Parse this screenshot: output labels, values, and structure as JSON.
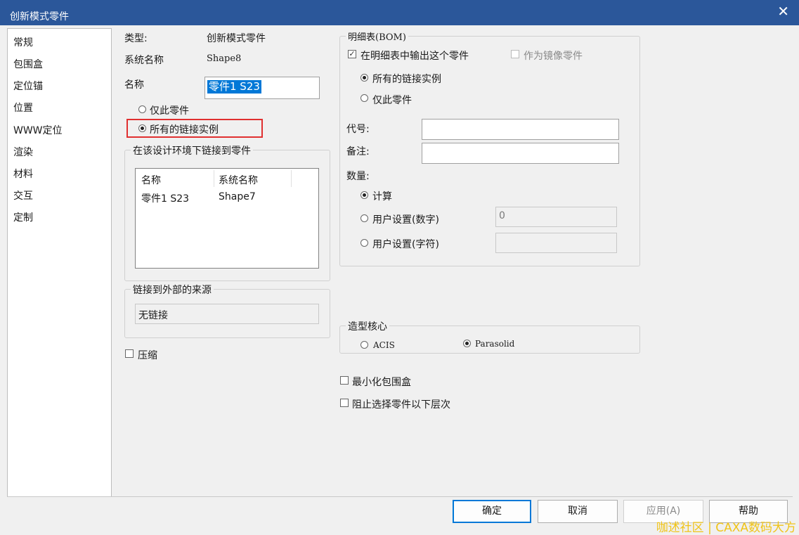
{
  "window": {
    "title": "创新模式零件",
    "close_glyph": "✕"
  },
  "sidebar": {
    "items": [
      "常规",
      "包围盒",
      "定位锚",
      "位置",
      "WWW定位",
      "渲染",
      "材料",
      "交互",
      "定制"
    ]
  },
  "general": {
    "type_label": "类型:",
    "type_value": "创新模式零件",
    "sysname_label": "系统名称",
    "sysname_value": "Shape8",
    "name_label": "名称",
    "name_value": "零件1 S23",
    "radio_only_this": "仅此零件",
    "radio_all_links": "所有的链接实例",
    "linked_group_title": "在该设计环境下链接到零件",
    "linked_table": {
      "headers": [
        "名称",
        "系统名称"
      ],
      "rows": [
        [
          "零件1 S23",
          "Shape7"
        ]
      ]
    },
    "external_group_title": "链接到外部的来源",
    "external_value": "无链接",
    "compress_label": "压缩"
  },
  "bom": {
    "group_title": "明细表(BOM)",
    "output_check": "在明细表中输出这个零件",
    "output_check_glyph": "✓",
    "mirror_check": "作为镜像零件",
    "radio_all_links": "所有的链接实例",
    "radio_only_this": "仅此零件",
    "code_label": "代号:",
    "remark_label": "备注:",
    "qty_label": "数量:",
    "qty_calc": "计算",
    "qty_user_number": "用户设置(数字)",
    "qty_user_number_value": "0",
    "qty_user_string": "用户设置(字符)"
  },
  "kernel": {
    "group_title": "造型核心",
    "acis": "ACIS",
    "parasolid": "Parasolid"
  },
  "options": {
    "min_bbox": "最小化包围盒",
    "block_select": "阻止选择零件以下层次"
  },
  "buttons": {
    "ok": "确定",
    "cancel": "取消",
    "apply": "应用(A)",
    "help": "帮助"
  },
  "watermark": "咖述社区 | CAXA数码大方",
  "colors": {
    "titlebar": "#2b579a",
    "highlight_box": "#e03030",
    "selection": "#0078d7"
  }
}
